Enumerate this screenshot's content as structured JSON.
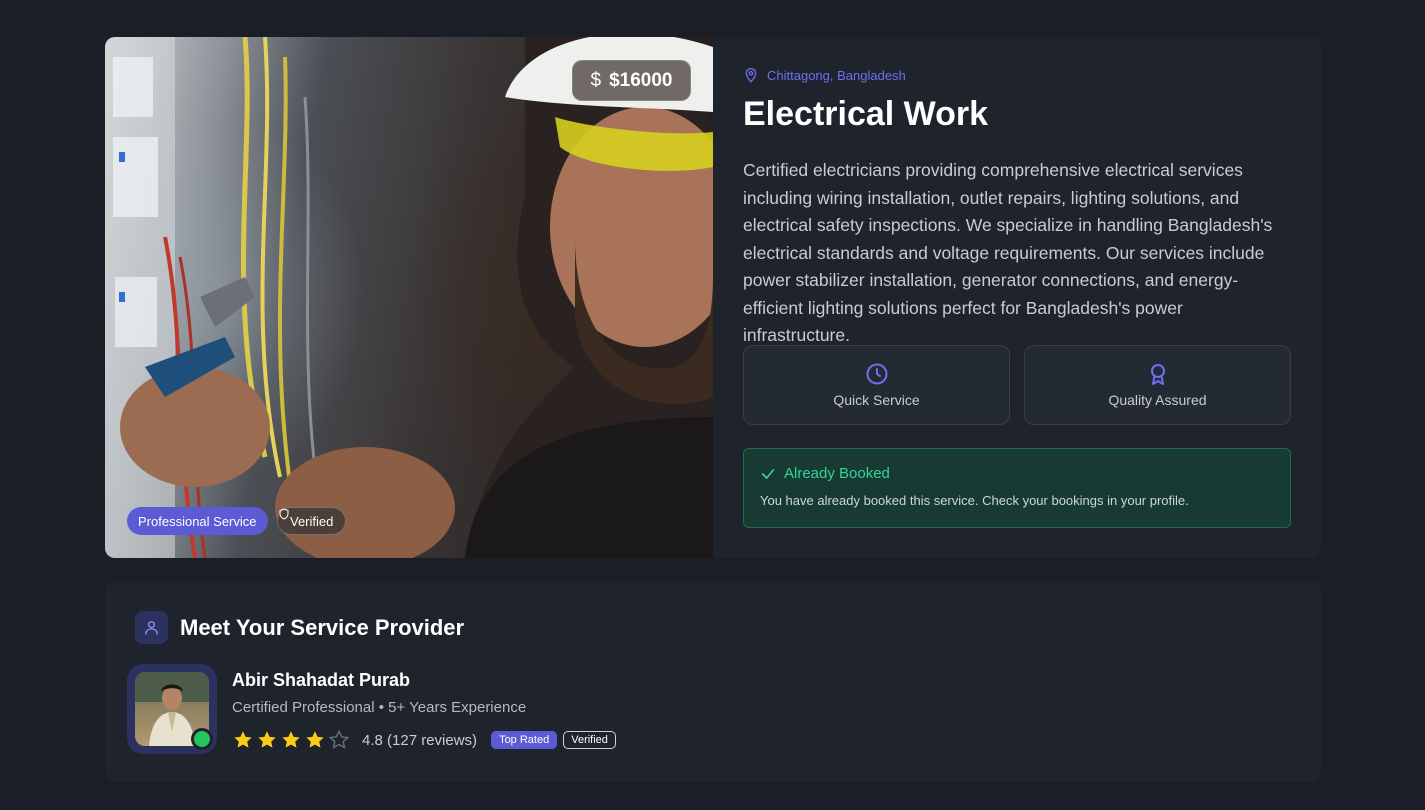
{
  "service": {
    "price_symbol": "$",
    "price": "$16000",
    "tags": {
      "professional": "Professional Service",
      "verified": "Verified"
    },
    "location": "Chittagong, Bangladesh",
    "title": "Electrical Work",
    "description": "Certified electricians providing comprehensive electrical services including wiring installation, outlet repairs, lighting solutions, and electrical safety inspections. We specialize in handling Bangladesh's electrical standards and voltage requirements. Our services include power stabilizer installation, generator connections, and energy-efficient lighting solutions perfect for Bangladesh's power infrastructure.",
    "features": [
      {
        "label": "Quick Service",
        "icon": "clock-icon"
      },
      {
        "label": "Quality Assured",
        "icon": "award-icon"
      }
    ],
    "booking_status": {
      "title": "Already Booked",
      "message": "You have already booked this service. Check your bookings in your profile."
    }
  },
  "provider": {
    "section_title": "Meet Your Service Provider",
    "name": "Abir Shahadat Purab",
    "subtitle": "Certified Professional • 5+ Years Experience",
    "rating": 4.8,
    "rating_text": "4.8 (127 reviews)",
    "stars_filled": 4,
    "stars_total": 5,
    "badges": {
      "top_rated": "Top Rated",
      "verified": "Verified"
    },
    "online": true
  },
  "colors": {
    "accent": "#5b5bd6",
    "success": "#34d399",
    "star": "#facc15",
    "background": "#1a1f27",
    "card": "#1e232c"
  }
}
